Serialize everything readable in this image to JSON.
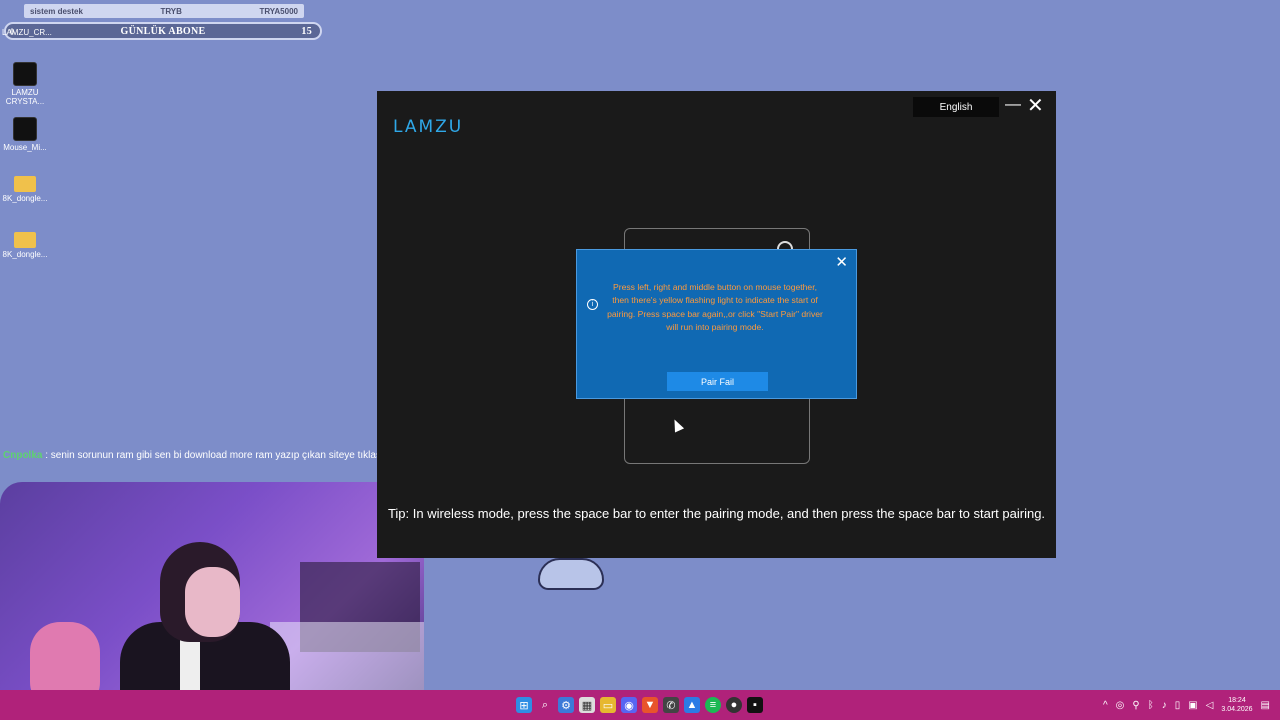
{
  "overlay": {
    "row1_left": "sistem destek",
    "row1_mid": "TRYB",
    "row1_right": "TRYA5000",
    "title": "GÜNLÜK ABONE",
    "count": "15",
    "zero": "0"
  },
  "desktop": {
    "icons": [
      {
        "label": "LAMZU_CR..."
      },
      {
        "label": "LAMZU CRYSTA..."
      },
      {
        "label": "Mouse_Mi..."
      },
      {
        "label": "8K_dongle..."
      },
      {
        "label": "8K_dongle..."
      }
    ]
  },
  "chat": {
    "user": "Cnpolka",
    "message": " : senin sorunun ram gibi sen bi download more ram yazıp çıkan siteye tıklasana"
  },
  "app": {
    "logo": "LAMZU",
    "language": "English",
    "minimize_label": "—",
    "close_label": "✕",
    "tip": "Tip: In wireless mode, press the space bar to enter the pairing mode, and then press the space bar to start pairing."
  },
  "modal": {
    "close_label": "✕",
    "info_glyph": "i",
    "message": "Press left, right and middle button on mouse together, then there's yellow flashing light to indicate the start of pairing. Press space bar again,,or click \"Start Pair\" driver will run into pairing mode.",
    "button": "Pair Fail"
  },
  "taskbar": {
    "icons": [
      "windows-icon",
      "search-icon",
      "settings-icon",
      "store-icon",
      "explorer-icon",
      "discord-icon",
      "brave-icon",
      "whatsapp-icon",
      "photos-icon",
      "spotify-icon",
      "github-icon",
      "terminal-icon"
    ],
    "time": "18:24",
    "date": "3.04.2026"
  }
}
